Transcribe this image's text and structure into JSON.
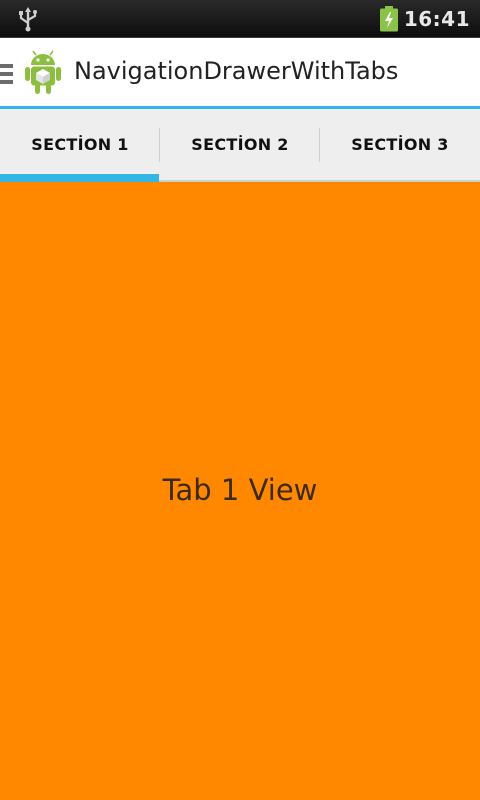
{
  "status_bar": {
    "time": "16:41",
    "icons": [
      "usb-icon",
      "battery-charging-icon"
    ]
  },
  "action_bar": {
    "title": "NavigationDrawerWithTabs",
    "icons": [
      "drawer-menu-icon",
      "android-app-icon"
    ]
  },
  "tabs": [
    {
      "label": "SECTİON 1",
      "selected": true
    },
    {
      "label": "SECTİON 2",
      "selected": false
    },
    {
      "label": "SECTİON 3",
      "selected": false
    }
  ],
  "content": {
    "label": "Tab 1 View",
    "background_color": "#ff8800"
  },
  "colors": {
    "accent": "#33b5e5",
    "content_background": "#ff8800",
    "battery": "#8bc34a"
  }
}
